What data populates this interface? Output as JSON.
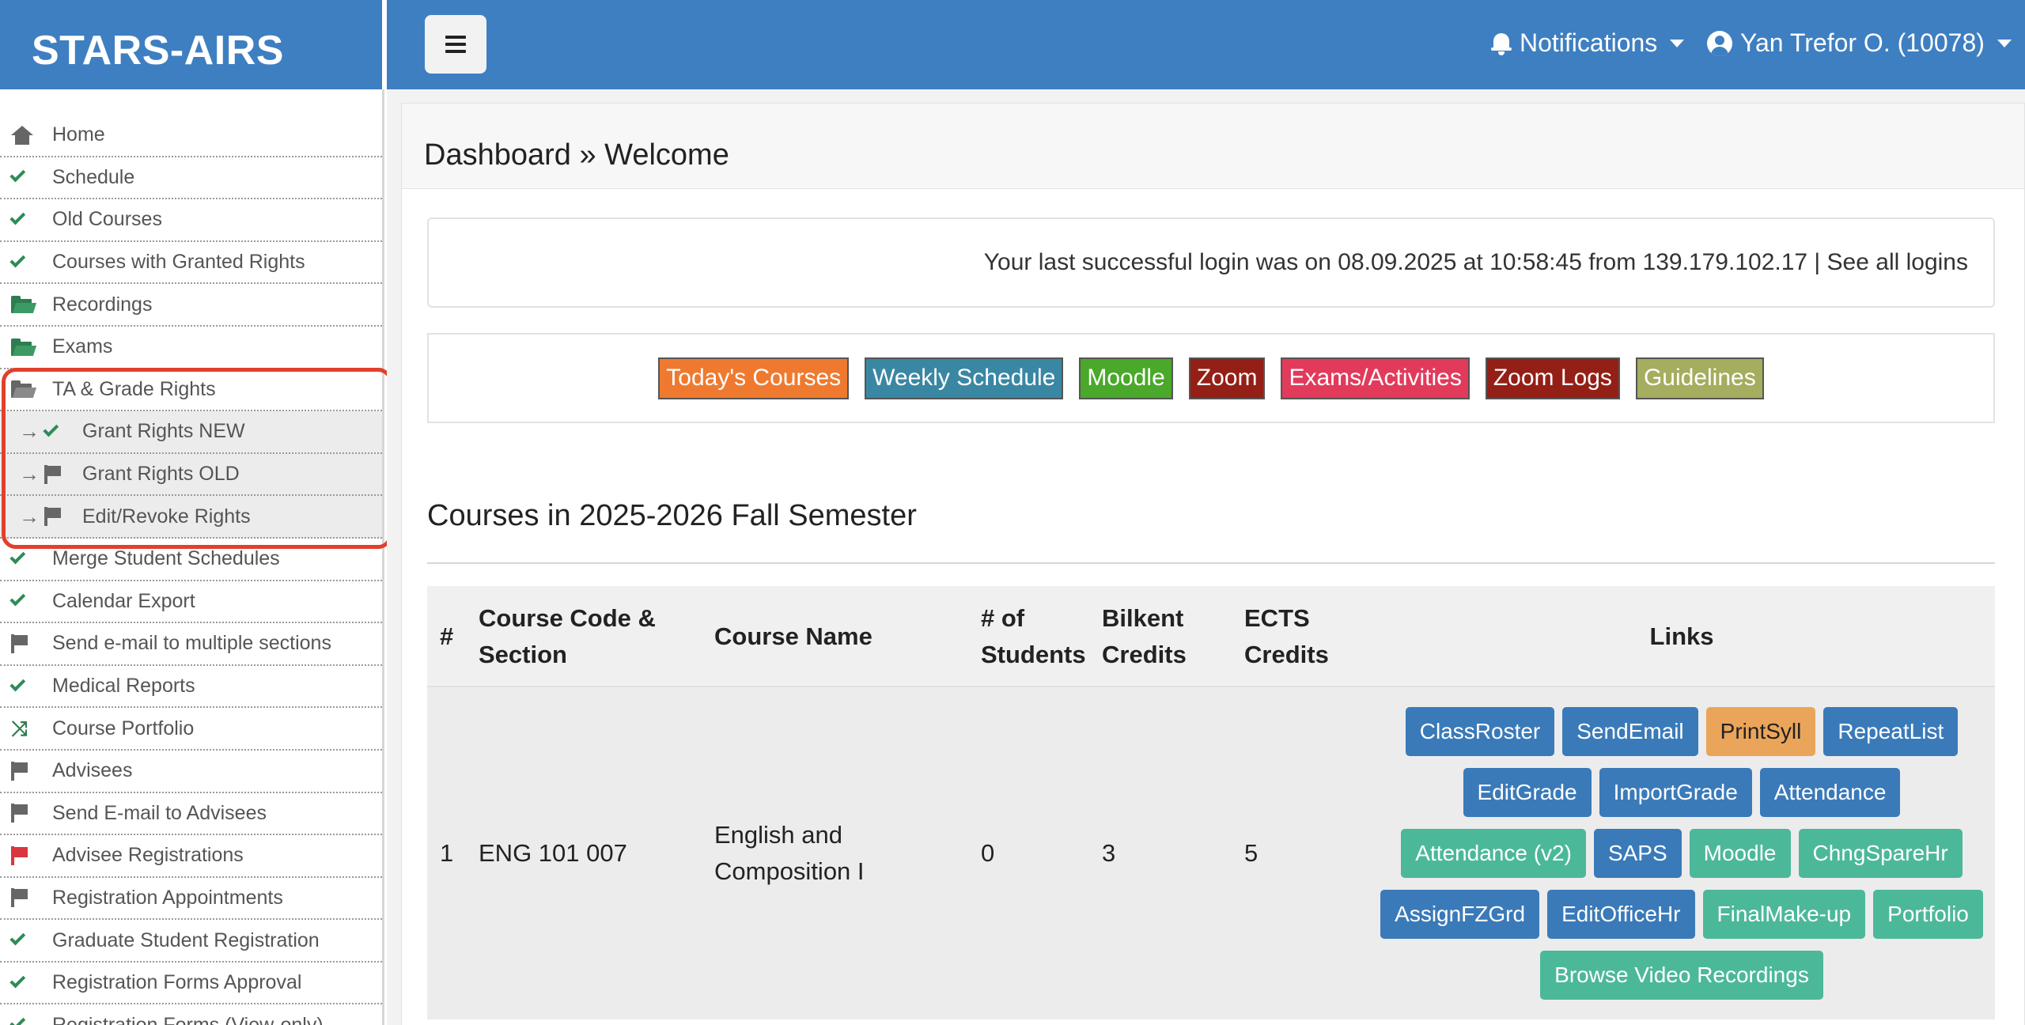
{
  "app": {
    "title": "STARS-AIRS"
  },
  "topbar": {
    "menu_toggle_icon": "bars-icon",
    "notifications_label": "Notifications",
    "user_label": "Yan Trefor O. (10078)"
  },
  "sidebar": {
    "items": [
      {
        "label": "Home",
        "icon": "home-icon"
      },
      {
        "label": "Schedule",
        "icon": "check-icon"
      },
      {
        "label": "Old Courses",
        "icon": "check-icon"
      },
      {
        "label": "Courses with Granted Rights",
        "icon": "check-icon"
      },
      {
        "label": "Recordings",
        "icon": "folder-open-icon"
      },
      {
        "label": "Exams",
        "icon": "folder-open-icon"
      },
      {
        "label": "TA & Grade Rights",
        "icon": "folder-open-icon"
      },
      {
        "label": "Grant Rights NEW",
        "icon": "check-icon",
        "sub": true
      },
      {
        "label": "Grant Rights OLD",
        "icon": "flag-icon",
        "sub": true
      },
      {
        "label": "Edit/Revoke Rights",
        "icon": "flag-icon",
        "sub": true
      },
      {
        "label": "Merge Student Schedules",
        "icon": "check-icon"
      },
      {
        "label": "Calendar Export",
        "icon": "check-icon"
      },
      {
        "label": "Send e-mail to multiple sections",
        "icon": "flag-icon"
      },
      {
        "label": "Medical Reports",
        "icon": "check-icon"
      },
      {
        "label": "Course Portfolio",
        "icon": "shuffle-icon"
      },
      {
        "label": "Advisees",
        "icon": "flag-icon"
      },
      {
        "label": "Send E-mail to Advisees",
        "icon": "flag-icon"
      },
      {
        "label": "Advisee Registrations",
        "icon": "flag-icon",
        "color": "#d9363e"
      },
      {
        "label": "Registration Appointments",
        "icon": "flag-icon"
      },
      {
        "label": "Graduate Student Registration",
        "icon": "check-icon"
      },
      {
        "label": "Registration Forms Approval",
        "icon": "check-icon"
      },
      {
        "label": "Registration Forms (View-only)",
        "icon": "check-icon"
      }
    ],
    "sub_arrow": "→"
  },
  "main": {
    "breadcrumb": "Dashboard » Welcome",
    "login_info": "Your last successful login was on 08.09.2025 at 10:58:45 from 139.179.102.17 | See all logins",
    "quick_links": [
      {
        "label": "Today's Courses",
        "color": "#ef7a2f"
      },
      {
        "label": "Weekly Schedule",
        "color": "#3a87a3"
      },
      {
        "label": "Moodle",
        "color": "#4aa82a"
      },
      {
        "label": "Zoom",
        "color": "#941f16"
      },
      {
        "label": "Exams/Activities",
        "color": "#e23a5b"
      },
      {
        "label": "Zoom Logs",
        "color": "#941f16"
      },
      {
        "label": "Guidelines",
        "color": "#a5ad5e"
      }
    ],
    "courses_title": "Courses in 2025-2026 Fall Semester",
    "table": {
      "headers": {
        "num": "#",
        "code": "Course Code & Section",
        "name": "Course Name",
        "students": "# of Students",
        "bilkent": "Bilkent Credits",
        "ects": "ECTS Credits",
        "links": "Links"
      },
      "rows": [
        {
          "num": "1",
          "code": "ENG 101 007",
          "name": "English and Composition I",
          "students": "0",
          "bilkent": "3",
          "ects": "5",
          "links": [
            {
              "label": "ClassRoster",
              "color": "#3a7ab9"
            },
            {
              "label": "SendEmail",
              "color": "#3a7ab9"
            },
            {
              "label": "PrintSyll",
              "color": "#eba55a"
            },
            {
              "label": "RepeatList",
              "color": "#3a7ab9"
            },
            {
              "label": "EditGrade",
              "color": "#3a7ab9"
            },
            {
              "label": "ImportGrade",
              "color": "#3a7ab9"
            },
            {
              "label": "Attendance",
              "color": "#3a7ab9"
            },
            {
              "label": "Attendance (v2)",
              "color": "#4cb89a"
            },
            {
              "label": "SAPS",
              "color": "#3a7ab9"
            },
            {
              "label": "Moodle",
              "color": "#4cb89a"
            },
            {
              "label": "ChngSpareHr",
              "color": "#4cb89a"
            },
            {
              "label": "AssignFZGrd",
              "color": "#3a7ab9"
            },
            {
              "label": "EditOfficeHr",
              "color": "#3a7ab9"
            },
            {
              "label": "FinalMake-up",
              "color": "#4cb89a"
            },
            {
              "label": "Portfolio",
              "color": "#4cb89a"
            },
            {
              "label": "Browse Video Recordings",
              "color": "#4cb89a"
            }
          ]
        }
      ]
    }
  },
  "colors": {
    "header_blue": "#3e7fc1",
    "highlight_red": "#e2402c",
    "check_green": "#2e8b57"
  }
}
